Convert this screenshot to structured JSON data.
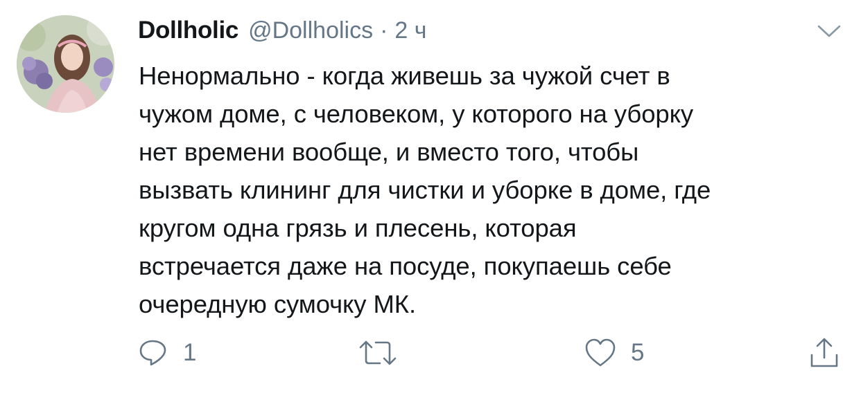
{
  "author": {
    "display_name": "Dollholic",
    "handle": "@Dollholics",
    "separator": "·",
    "time": "2 ч"
  },
  "tweet": {
    "text": "Ненормально - когда живешь за чужой счет в\nчужом доме, с человеком, у которого на уборку\nнет времени вообще, и вместо того, чтобы\nвызвать клининг для чистки и уборке в доме, где\nкругом одна грязь и плесень, которая\nвстречается даже на посуде, покупаешь себе\nочередную сумочку МК."
  },
  "actions": {
    "reply_count": "1",
    "retweet_count": "",
    "like_count": "5"
  },
  "icons": {
    "reply": "reply-icon",
    "retweet": "retweet-icon",
    "like": "heart-icon",
    "share": "share-icon",
    "menu": "chevron-down-icon"
  },
  "colors": {
    "text": "#14171a",
    "secondary": "#657786"
  }
}
